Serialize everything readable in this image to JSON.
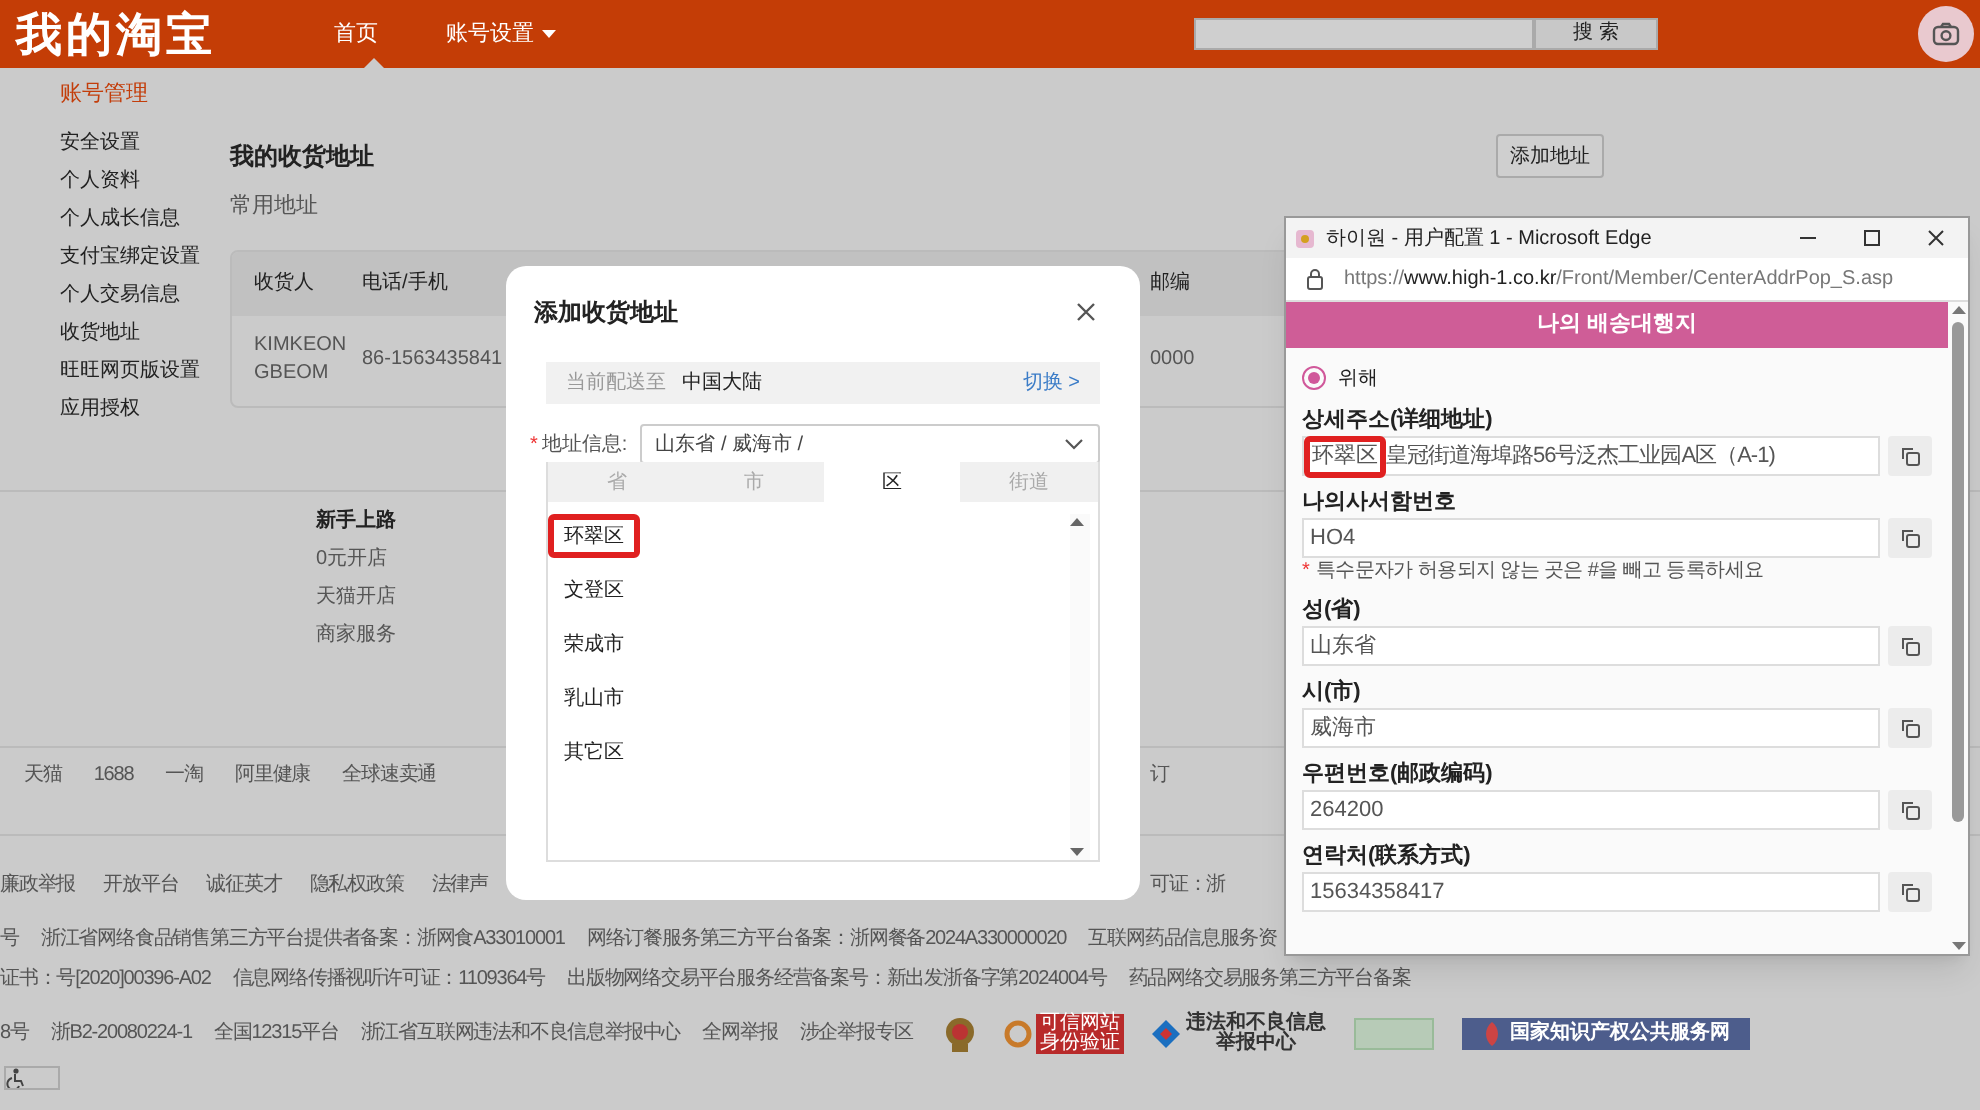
{
  "header": {
    "logo": "我的淘宝",
    "nav": [
      {
        "label": "首页",
        "selected": true,
        "dropdown": false
      },
      {
        "label": "账号设置",
        "selected": false,
        "dropdown": true
      }
    ],
    "search_button": "搜 索"
  },
  "sidebar": {
    "title": "账号管理",
    "items": [
      "安全设置",
      "个人资料",
      "个人成长信息",
      "支付宝绑定设置",
      "个人交易信息",
      "收货地址",
      "旺旺网页版设置",
      "应用授权"
    ]
  },
  "content": {
    "title": "我的收货地址",
    "add_button": "添加地址",
    "section": "常用地址",
    "table": {
      "columns": [
        "收货人",
        "电话/手机",
        "邮编"
      ],
      "rows": [
        [
          "KIMKEON GBEOM",
          "86-1563435841",
          "0000"
        ]
      ]
    }
  },
  "footer": {
    "seller_links": {
      "title": "新手上路",
      "items": [
        "0元开店",
        "天猫开店",
        "商家服务"
      ]
    },
    "rows": [
      {
        "items": [
          "天猫",
          "1688",
          "一淘",
          "阿里健康",
          "全球速卖通"
        ],
        "tail": [
          "订"
        ]
      },
      {
        "items": [
          "廉政举报",
          "开放平台",
          "诚征英才",
          "隐私权政策",
          "法律声"
        ],
        "tail": [
          "可证：浙"
        ]
      },
      {
        "items": [
          "号",
          "浙江省网络食品销售第三方平台提供者备案：浙网食A33010001",
          "网络订餐服务第三方平台备案：浙网餐备2024A330000020",
          "互联网药品信息服务资"
        ],
        "tail": []
      },
      {
        "items": [
          "证书：号[2020]00396-A02",
          "信息网络传播视听许可证：1109364号",
          "出版物网络交易平台服务经营备案号：新出发浙备字第2024004号",
          "药品网络交易服务第三方平台备案"
        ],
        "tail": []
      },
      {
        "items": [
          "8号",
          "浙B2-20080224-1",
          "全国12315平台",
          "浙江省互联网违法和不良信息举报中心",
          "全网举报",
          "涉企举报专区"
        ],
        "tail": []
      }
    ],
    "badges": [
      {
        "kind": "emblem"
      },
      {
        "kind": "red",
        "lines": [
          "可信网站",
          "身份验证"
        ]
      },
      {
        "kind": "report",
        "lines": [
          "违法和不良信息",
          "举报中心"
        ]
      },
      {
        "kind": "certificate"
      },
      {
        "kind": "banner",
        "lines": [
          "国家知识产权公共服务网"
        ]
      }
    ]
  },
  "dialog": {
    "title": "添加收货地址",
    "ship_label": "当前配送至",
    "ship_value": "中国大陆",
    "switch_link": "切换 >",
    "required_mark": "*",
    "address_label": "地址信息:",
    "address_value": "山东省 / 威海市 /",
    "tabs": [
      {
        "label": "省",
        "selected": false
      },
      {
        "label": "市",
        "selected": false
      },
      {
        "label": "区",
        "selected": true
      },
      {
        "label": "街道",
        "selected": false
      }
    ],
    "options": [
      {
        "label": "环翠区",
        "highlighted": true
      },
      {
        "label": "文登区",
        "highlighted": false
      },
      {
        "label": "荣成市",
        "highlighted": false
      },
      {
        "label": "乳山市",
        "highlighted": false
      },
      {
        "label": "其它区",
        "highlighted": false
      }
    ]
  },
  "popup": {
    "title": "하이원 - 用户配置 1 - Microsoft Edge",
    "url_prefix": "https://",
    "url_host": "www.high-1.co.kr",
    "url_path": "/Front/Member/CenterAddrPop_S.asp",
    "heading": "나의 배송대행지",
    "radios": [
      {
        "label": "위해",
        "selected": true
      }
    ],
    "fields": [
      {
        "label": "상세주소(详细地址)",
        "marked": "环翠区",
        "value": "皇冠街道海埠路56号泛杰工业园A区（A-1)"
      },
      {
        "label": "나의사서함번호",
        "value": "HO4",
        "note_mark": "*",
        "note": "특수문자가 허용되지 않는 곳은 #을 빼고 등록하세요"
      },
      {
        "label": "성(省)",
        "value": "山东省"
      },
      {
        "label": "시(市)",
        "value": "威海市"
      },
      {
        "label": "우편번호(邮政编码)",
        "value": "264200"
      },
      {
        "label": "연락처(联系方式)",
        "value": "15634358417"
      }
    ]
  }
}
